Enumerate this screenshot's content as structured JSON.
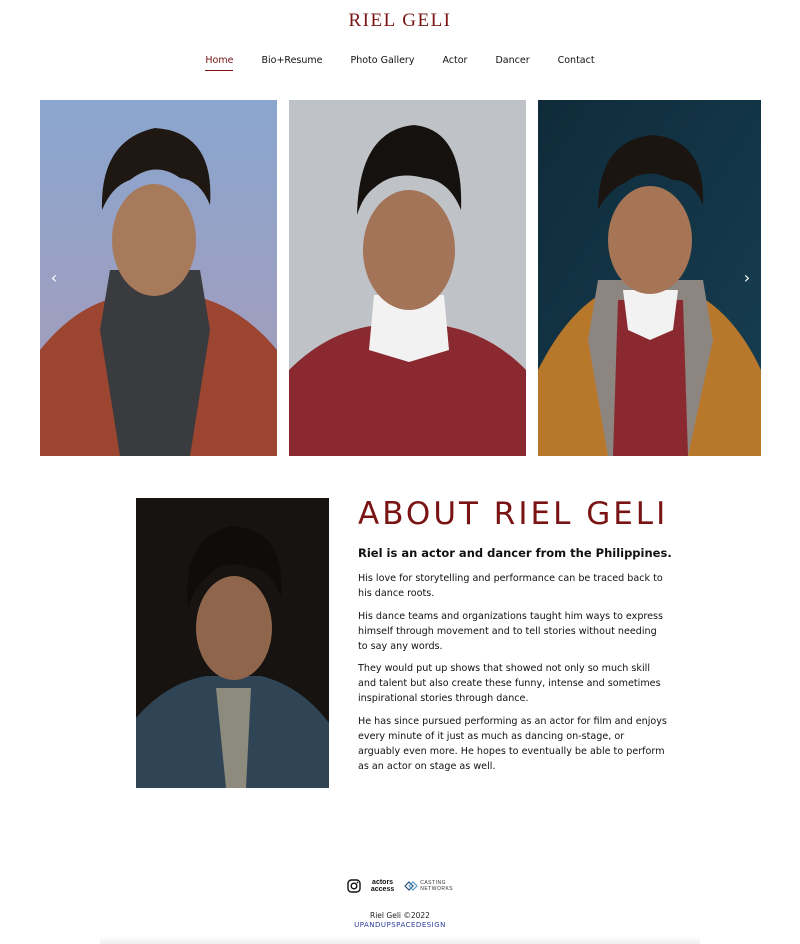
{
  "site": {
    "title": "RIEL GELI"
  },
  "nav": {
    "items": [
      {
        "label": "Home",
        "active": true
      },
      {
        "label": "Bio+Resume"
      },
      {
        "label": "Photo Gallery"
      },
      {
        "label": "Actor"
      },
      {
        "label": "Dancer"
      },
      {
        "label": "Contact"
      }
    ]
  },
  "carousel": {
    "prev_icon": "chevron-left-icon",
    "next_icon": "chevron-right-icon",
    "prev_glyph": "‹",
    "next_glyph": "›"
  },
  "about": {
    "heading": "ABOUT RIEL GELI",
    "lead": "Riel is an actor and dancer from the Philippines.",
    "paragraphs": [
      "His love for storytelling and performance can be traced back to his dance roots.",
      "His dance teams and organizations taught him ways to express himself through movement and to tell stories without needing to say any words.",
      "They would put up shows that showed not only so much skill and talent but also create these funny, intense and sometimes inspirational stories through dance.",
      "He has since pursued performing as an actor for film and enjoys every minute of it just as much as dancing on-stage, or arguably even more. He hopes to eventually be able to perform as an actor on stage as well."
    ]
  },
  "footer": {
    "actors_access_line1": "actors",
    "actors_access_line2": "access",
    "casting_line1": "CASTING",
    "casting_line2": "NETWORKS",
    "copyright": "Riel Geli ©2022",
    "designer": "UPANDUPSPACEDESIGN"
  },
  "colors": {
    "accent": "#7a1414",
    "link": "#2a3a9a"
  }
}
